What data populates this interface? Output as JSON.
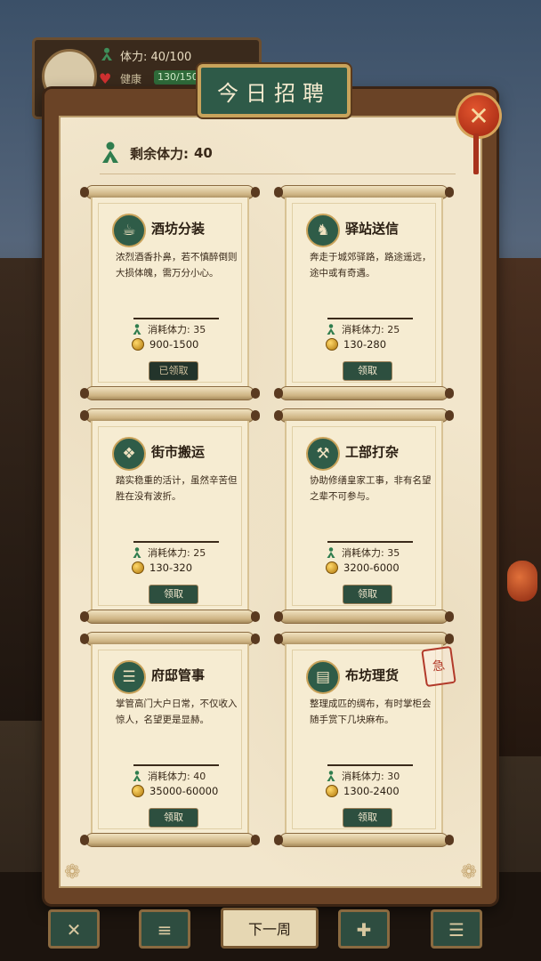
{
  "status": {
    "stamina_text": "体力: 40/100",
    "health_label": "健康",
    "health_value": "130/150",
    "health_level": 0.87
  },
  "title": "今日招聘",
  "stamina": {
    "label": "剩余体力:",
    "value": "40"
  },
  "jobs": [
    {
      "title": "酒坊分装",
      "icon": "teapot-icon",
      "desc": "浓烈酒香扑鼻，若不慎醉倒则大损体魄，需万分小心。",
      "cost": "消耗体力: 35",
      "pay": "900-1500",
      "button": "已领取",
      "claimed": true
    },
    {
      "title": "驿站送信",
      "icon": "horse-icon",
      "desc": "奔走于城郊驿路，路途遥远，途中或有奇遇。",
      "cost": "消耗体力: 25",
      "pay": "130-280",
      "button": "领取",
      "claimed": false
    },
    {
      "title": "街市搬运",
      "icon": "sack-icon",
      "desc": "踏实稳重的活计，虽然辛苦但胜在没有波折。",
      "cost": "消耗体力: 25",
      "pay": "130-320",
      "button": "领取",
      "claimed": false
    },
    {
      "title": "工部打杂",
      "icon": "worker-icon",
      "desc": "协助修缮皇家工事，非有名望之辈不可参与。",
      "cost": "消耗体力: 35",
      "pay": "3200-6000",
      "button": "领取",
      "claimed": false
    },
    {
      "title": "府邸管事",
      "icon": "scroll-icon",
      "desc": "掌管高门大户日常，不仅收入惊人，名望更是显赫。",
      "cost": "消耗体力: 40",
      "pay": "35000-60000",
      "button": "领取",
      "claimed": false
    },
    {
      "title": "布坊理货",
      "icon": "ledger-icon",
      "desc": "整理成匹的绸布，有时掌柜会随手赏下几块麻布。",
      "cost": "消耗体力: 30",
      "pay": "1300-2400",
      "button": "领取",
      "claimed": false,
      "stamp": "急"
    }
  ],
  "bottom": {
    "next_week": "下一周"
  }
}
